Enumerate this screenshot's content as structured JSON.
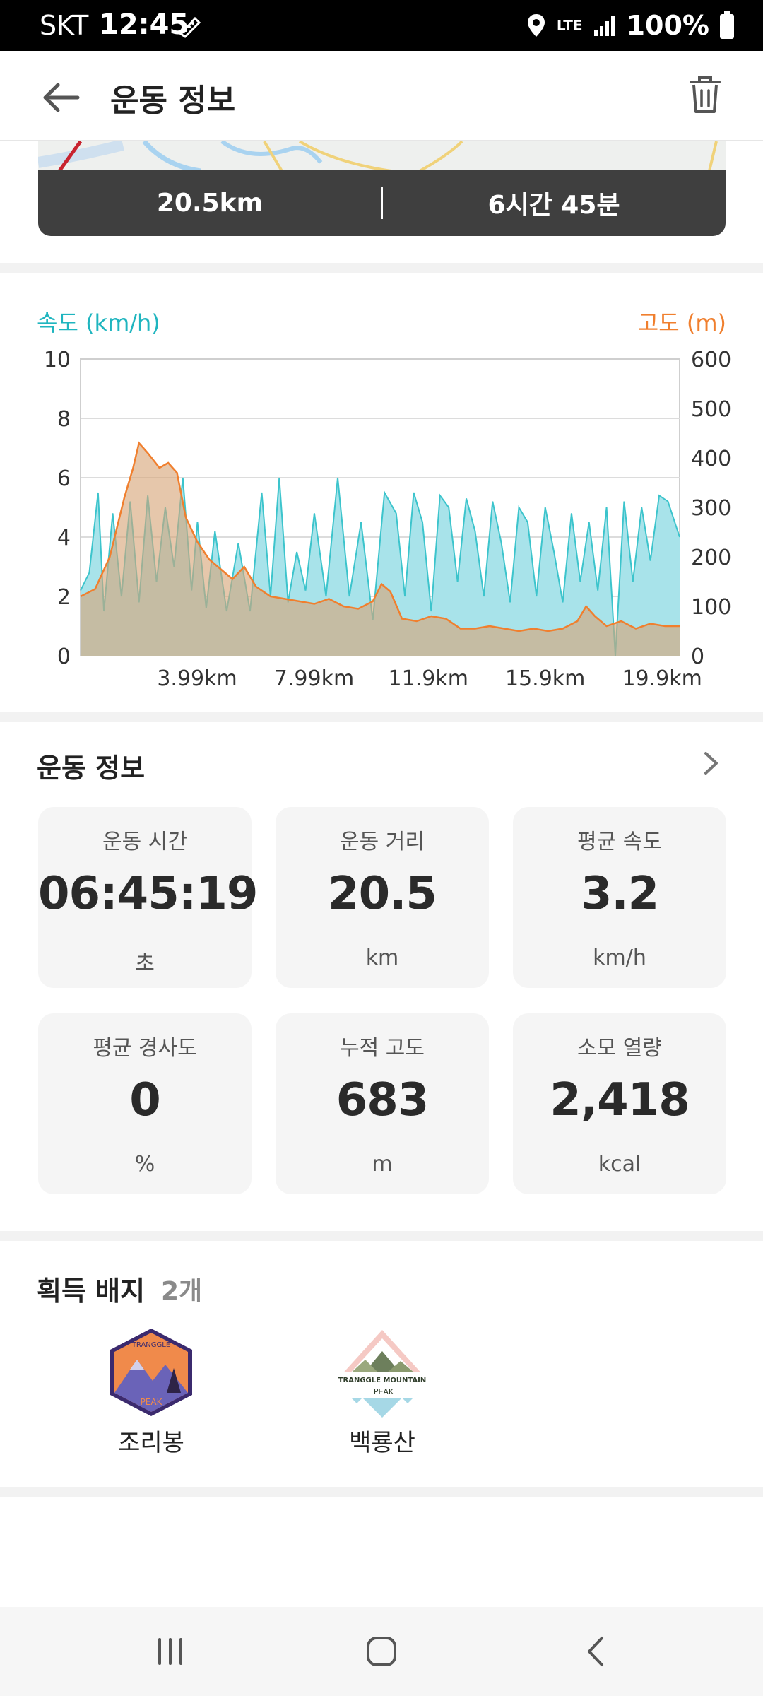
{
  "status_bar": {
    "carrier": "SKT",
    "time": "12:45",
    "network": "LTE",
    "battery": "100%"
  },
  "app_bar": {
    "title": "운동 정보"
  },
  "summary": {
    "distance": "20.5km",
    "duration": "6시간 45분"
  },
  "chart_data": {
    "type": "area",
    "title": "",
    "y_left_label": "속도 (km/h)",
    "y_right_label": "고도 (m)",
    "y_left_ticks": [
      "10",
      "8",
      "6",
      "4",
      "2",
      "0"
    ],
    "y_right_ticks": [
      "600",
      "500",
      "400",
      "300",
      "200",
      "100",
      "0"
    ],
    "y_left_range": [
      0,
      10
    ],
    "y_right_range": [
      0,
      600
    ],
    "x_range": [
      0,
      20.5
    ],
    "x_ticks": [
      "3.99km",
      "7.99km",
      "11.9km",
      "15.9km",
      "19.9km"
    ],
    "x_tick_values": [
      3.99,
      7.99,
      11.9,
      15.9,
      19.9
    ],
    "grid": true,
    "series": [
      {
        "name": "속도 (km/h)",
        "axis": "left",
        "color": "#3cc4cc",
        "x": [
          0,
          0.3,
          0.6,
          0.8,
          1.1,
          1.4,
          1.7,
          2.0,
          2.3,
          2.6,
          2.9,
          3.2,
          3.5,
          3.8,
          4.0,
          4.3,
          4.6,
          5.0,
          5.4,
          5.8,
          6.2,
          6.5,
          6.8,
          7.1,
          7.4,
          7.7,
          8.0,
          8.4,
          8.8,
          9.2,
          9.6,
          10.0,
          10.4,
          10.8,
          11.1,
          11.4,
          11.7,
          12.0,
          12.3,
          12.6,
          12.9,
          13.2,
          13.5,
          13.8,
          14.1,
          14.4,
          14.7,
          15.0,
          15.3,
          15.6,
          15.9,
          16.2,
          16.5,
          16.8,
          17.1,
          17.4,
          17.7,
          18.0,
          18.3,
          18.6,
          18.9,
          19.2,
          19.5,
          19.8,
          20.1,
          20.5
        ],
        "y": [
          2.2,
          2.8,
          5.5,
          1.5,
          4.8,
          2.0,
          5.2,
          1.8,
          5.4,
          2.5,
          5.0,
          3.0,
          6.0,
          2.2,
          4.5,
          1.6,
          4.2,
          1.5,
          3.8,
          1.5,
          5.5,
          2.0,
          6.0,
          1.8,
          3.5,
          2.2,
          4.8,
          2.0,
          6.0,
          2.0,
          4.5,
          1.2,
          5.5,
          4.8,
          2.0,
          5.5,
          4.5,
          1.5,
          5.4,
          5.0,
          2.5,
          5.3,
          4.2,
          2.0,
          5.2,
          3.8,
          1.8,
          5.0,
          4.5,
          2.0,
          5.0,
          3.5,
          1.8,
          4.8,
          2.5,
          4.5,
          2.2,
          5.0,
          0.0,
          5.2,
          2.5,
          5.0,
          3.2,
          5.4,
          5.2,
          4.0
        ]
      },
      {
        "name": "고도 (m)",
        "axis": "right",
        "color": "#f59a5c",
        "x": [
          0,
          0.5,
          1.0,
          1.5,
          1.8,
          2.0,
          2.3,
          2.7,
          3.0,
          3.3,
          3.6,
          4.0,
          4.4,
          4.8,
          5.2,
          5.6,
          6.0,
          6.5,
          7.0,
          7.5,
          8.0,
          8.5,
          9.0,
          9.5,
          10.0,
          10.3,
          10.6,
          11.0,
          11.5,
          12.0,
          12.5,
          13.0,
          13.5,
          14.0,
          14.5,
          15.0,
          15.5,
          16.0,
          16.5,
          17.0,
          17.3,
          17.6,
          18.0,
          18.5,
          19.0,
          19.5,
          20.0,
          20.5
        ],
        "y": [
          120,
          135,
          200,
          320,
          380,
          430,
          410,
          380,
          390,
          370,
          280,
          230,
          195,
          175,
          155,
          180,
          140,
          120,
          115,
          110,
          105,
          115,
          100,
          95,
          110,
          145,
          130,
          75,
          70,
          80,
          75,
          55,
          55,
          60,
          55,
          50,
          55,
          50,
          55,
          70,
          100,
          80,
          60,
          70,
          55,
          65,
          60,
          60
        ]
      }
    ]
  },
  "workout_info": {
    "header": "운동 정보",
    "cards": [
      {
        "label": "운동 시간",
        "value": "06:45:19",
        "unit": "초"
      },
      {
        "label": "운동 거리",
        "value": "20.5",
        "unit": "km"
      },
      {
        "label": "평균 속도",
        "value": "3.2",
        "unit": "km/h"
      },
      {
        "label": "평균 경사도",
        "value": "0",
        "unit": "%"
      },
      {
        "label": "누적 고도",
        "value": "683",
        "unit": "m"
      },
      {
        "label": "소모 열량",
        "value": "2,418",
        "unit": "kcal"
      }
    ]
  },
  "badges": {
    "header": "획득 배지",
    "count": "2개",
    "items": [
      {
        "name": "조리봉",
        "logo_top": "TRANGGLE",
        "logo_bottom": "PEAK"
      },
      {
        "name": "백룡산",
        "logo_top": "TRANGGLE MOUNTAIN",
        "logo_bottom": "PEAK"
      }
    ]
  },
  "colors": {
    "speed": "#1fb5bf",
    "altitude": "#f07f2e",
    "summary_bg": "#3f3f3f"
  }
}
